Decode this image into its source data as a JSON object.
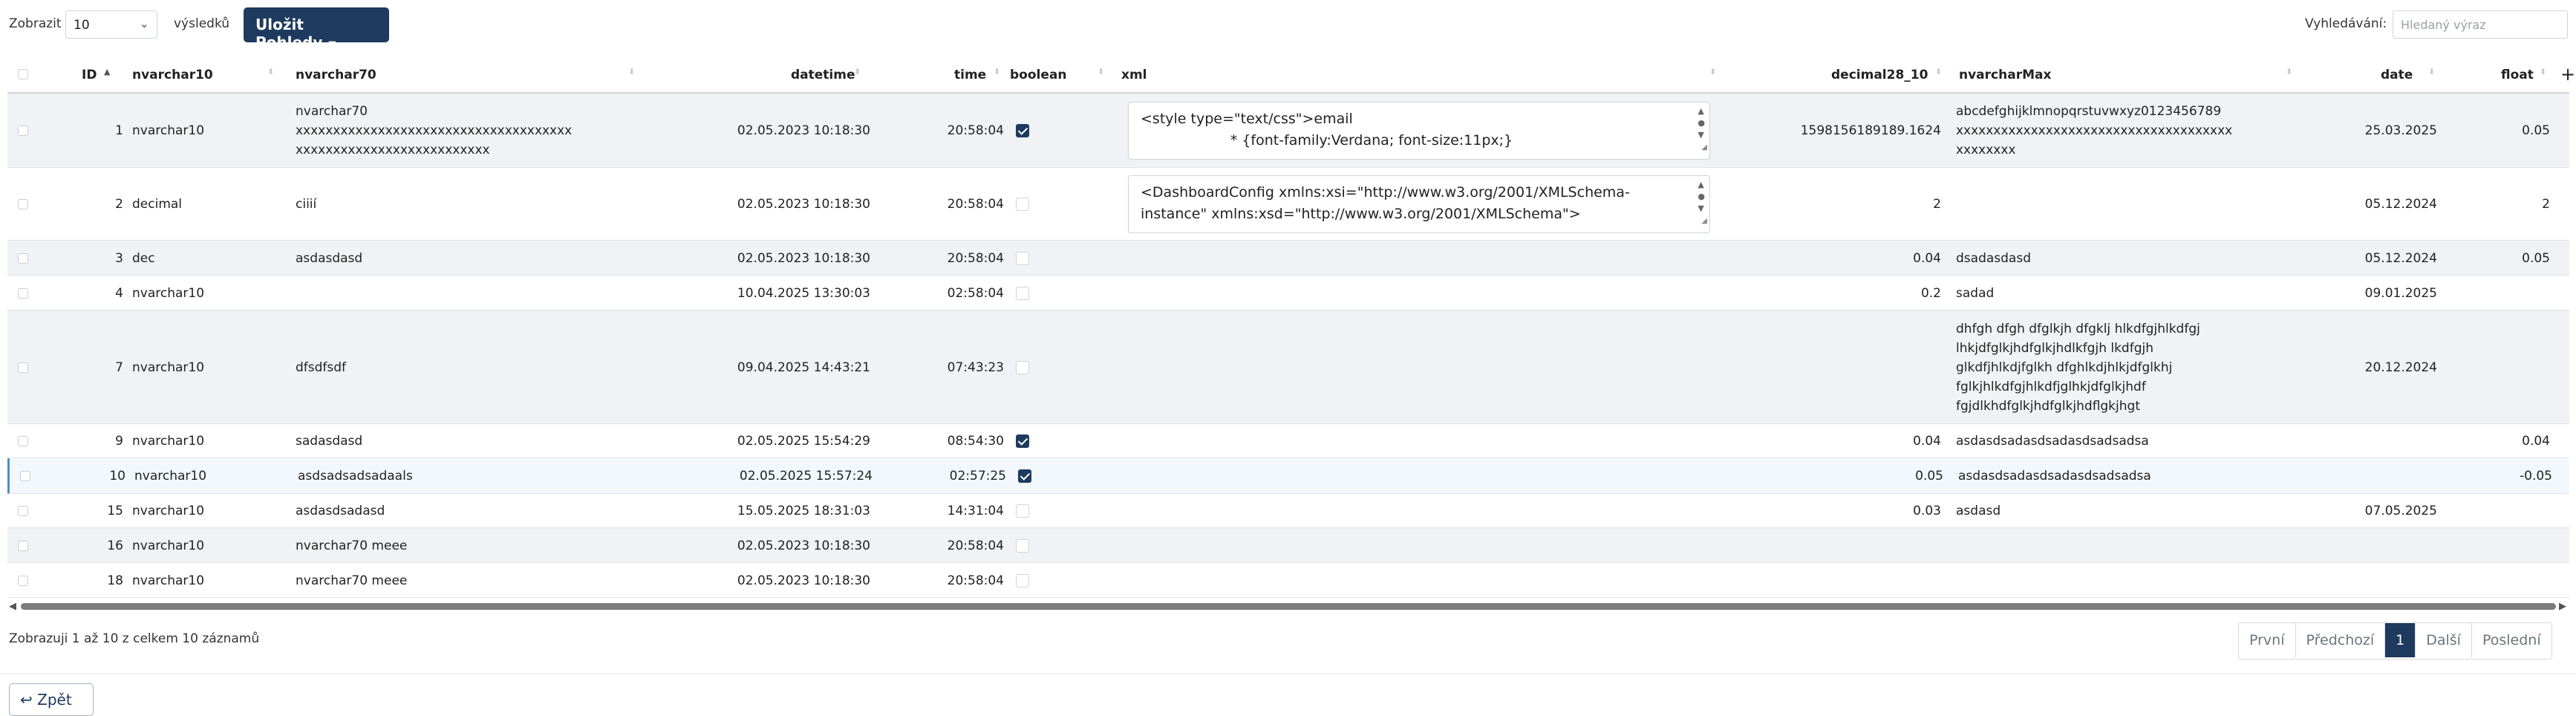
{
  "toolbar": {
    "show_label": "Zobrazit",
    "page_size": "10",
    "results_label": "výsledků",
    "save_views": "Uložit Pohledy",
    "search_label": "Vyhledávání:",
    "search_placeholder": "Hledaný výraz"
  },
  "columns": [
    "ID",
    "nvarchar10",
    "nvarchar70",
    "datetime",
    "time",
    "boolean",
    "xml",
    "decimal28_10",
    "nvarcharMax",
    "date",
    "float"
  ],
  "add_column": "+",
  "rows": [
    {
      "id": "1",
      "nvarchar10": "nvarchar10",
      "nvarchar70": [
        "nvarchar70",
        "xxxxxxxxxxxxxxxxxxxxxxxxxxxxxxxxxxxxx",
        "xxxxxxxxxxxxxxxxxxxxxxxxxx"
      ],
      "datetime": "02.05.2023 10:18:30",
      "time": "20:58:04",
      "boolean": true,
      "xml": "<style type=\"text/css\">email\n                    * {font-family:Verdana; font-size:11px;}",
      "decimal": "1598156189189.1624",
      "nvarcharMax": [
        "abcdefghijklmnopqrstuvwxyz0123456789",
        "xxxxxxxxxxxxxxxxxxxxxxxxxxxxxxxxxxxxx",
        "xxxxxxxx"
      ],
      "date": "25.03.2025",
      "float": "0.05"
    },
    {
      "id": "2",
      "nvarchar10": "decimal",
      "nvarchar70": [
        "ciiií"
      ],
      "datetime": "02.05.2023 10:18:30",
      "time": "20:58:04",
      "boolean": false,
      "xml": "<DashboardConfig xmlns:xsi=\"http://www.w3.org/2001/XMLSchema-\ninstance\" xmlns:xsd=\"http://www.w3.org/2001/XMLSchema\">",
      "decimal": "2",
      "nvarcharMax": [],
      "date": "05.12.2024",
      "float": "2"
    },
    {
      "id": "3",
      "nvarchar10": "dec",
      "nvarchar70": [
        "asdasdasd"
      ],
      "datetime": "02.05.2023 10:18:30",
      "time": "20:58:04",
      "boolean": false,
      "xml": "",
      "decimal": "0.04",
      "nvarcharMax": [
        "dsadasdasd"
      ],
      "date": "05.12.2024",
      "float": "0.05"
    },
    {
      "id": "4",
      "nvarchar10": "nvarchar10",
      "nvarchar70": [],
      "datetime": "10.04.2025 13:30:03",
      "time": "02:58:04",
      "boolean": false,
      "xml": "",
      "decimal": "0.2",
      "nvarcharMax": [
        "sadad"
      ],
      "date": "09.01.2025",
      "float": ""
    },
    {
      "id": "7",
      "nvarchar10": "nvarchar10",
      "nvarchar70": [
        "dfsdfsdf"
      ],
      "datetime": "09.04.2025 14:43:21",
      "time": "07:43:23",
      "boolean": false,
      "xml": "",
      "decimal": "",
      "nvarcharMax": [
        "dhfgh dfgh dfglkjh dfgklj hlkdfgjhlkdfgj",
        "lhkjdfglkjhdfglkjhdlkfgjh lkdfgjh",
        "glkdfjhlkdjfglkh dfghlkdjhlkjdfglkhj",
        "fglkjhlkdfgjhlkdfjglhkjdfglkjhdf",
        "fgjdlkhdfglkjhdfglkjhdflgkjhgt"
      ],
      "date": "20.12.2024",
      "float": ""
    },
    {
      "id": "9",
      "nvarchar10": "nvarchar10",
      "nvarchar70": [
        "sadasdasd"
      ],
      "datetime": "02.05.2025 15:54:29",
      "time": "08:54:30",
      "boolean": true,
      "xml": "",
      "decimal": "0.04",
      "nvarcharMax": [
        "asdasdsadasdsadasdsadsadsa"
      ],
      "date": "",
      "float": "0.04"
    },
    {
      "id": "10",
      "nvarchar10": "nvarchar10",
      "nvarchar70": [
        "asdsadsadsadaals"
      ],
      "datetime": "02.05.2025 15:57:24",
      "time": "02:57:25",
      "boolean": true,
      "xml": "",
      "decimal": "0.05",
      "nvarcharMax": [
        "asdasdsadasdsadasdsadsadsa"
      ],
      "date": "",
      "float": "-0.05"
    },
    {
      "id": "15",
      "nvarchar10": "nvarchar10",
      "nvarchar70": [
        "asdasdsadasd"
      ],
      "datetime": "15.05.2025 18:31:03",
      "time": "14:31:04",
      "boolean": false,
      "xml": "",
      "decimal": "0.03",
      "nvarcharMax": [
        "asdasd"
      ],
      "date": "07.05.2025",
      "float": ""
    },
    {
      "id": "16",
      "nvarchar10": "nvarchar10",
      "nvarchar70": [
        "nvarchar70 meee"
      ],
      "datetime": "02.05.2023 10:18:30",
      "time": "20:58:04",
      "boolean": false,
      "xml": "",
      "decimal": "",
      "nvarcharMax": [],
      "date": "",
      "float": ""
    },
    {
      "id": "18",
      "nvarchar10": "nvarchar10",
      "nvarchar70": [
        "nvarchar70 meee"
      ],
      "datetime": "02.05.2023 10:18:30",
      "time": "20:58:04",
      "boolean": false,
      "xml": "",
      "decimal": "",
      "nvarcharMax": [],
      "date": "",
      "float": ""
    }
  ],
  "footer": {
    "info": "Zobrazuji 1 až 10 z celkem 10 záznamů",
    "pages": [
      "První",
      "Předchozí",
      "1",
      "Další",
      "Poslední"
    ],
    "active_page": "1"
  },
  "back_label": "Zpět"
}
